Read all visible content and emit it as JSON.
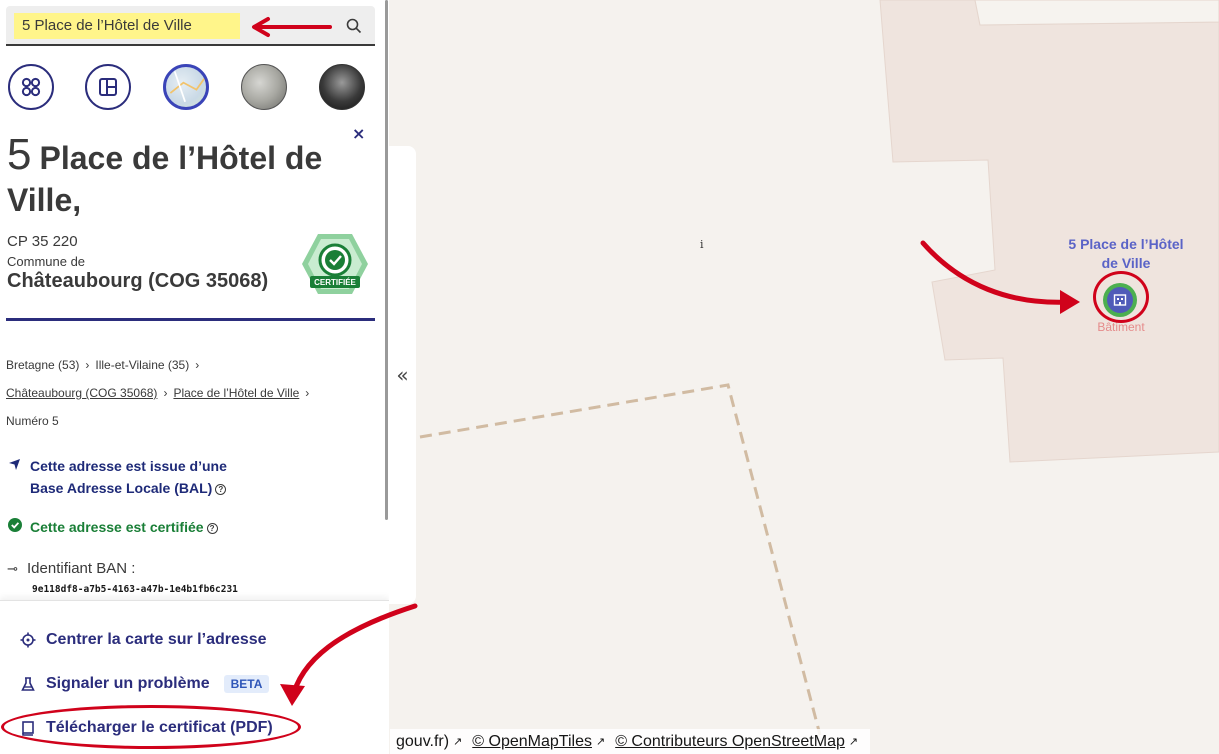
{
  "search": {
    "value": "5 Place de l’Hôtel de Ville"
  },
  "map_styles": [
    {
      "icon": "grid-four-icon",
      "label": ""
    },
    {
      "icon": "layout-icon",
      "label": ""
    },
    {
      "icon": "plan-thumbnail",
      "label": ""
    },
    {
      "icon": "photo-thumbnail",
      "label": ""
    },
    {
      "icon": "dark-thumbnail",
      "label": ""
    }
  ],
  "address": {
    "number": "5",
    "street": "Place de l’Hôtel de Ville,",
    "postal_code": "CP 35 220",
    "commune_label": "Commune de",
    "commune_name": "Châteaubourg (COG 35068)",
    "badge_text": "CERTIFIÉE",
    "breadcrumb": {
      "region": "Bretagne (53)",
      "departement": "Ille-et-Vilaine (35)",
      "commune": "Châteaubourg (COG 35068)",
      "voie": "Place de l’Hôtel de Ville",
      "numero": "Numéro 5"
    },
    "bal_line1": "Cette adresse est issue d’une",
    "bal_line2": "Base Adresse Locale (BAL)",
    "certified_text": "Cette adresse est certifiée",
    "ban_label": "Identifiant BAN :",
    "ban_id": "9e118df8-a7b5-4163-a47b-1e4b1fb6c231"
  },
  "actions": {
    "center": "Centrer la carte sur l’adresse",
    "report": "Signaler un problème",
    "report_badge": "BETA",
    "download": "Télécharger le certificat (PDF)"
  },
  "map": {
    "info_glyph": "i",
    "poi_label": "5 Place de l’Hôtel de Ville",
    "poi_type": "Bâtiment",
    "collapse_glyph": "«"
  },
  "attribution": {
    "part1": "gouv.fr)",
    "part2": "© OpenMapTiles",
    "part3": "© Contributeurs OpenStreetMap"
  },
  "colors": {
    "primary": "#2b2d7c",
    "certified_green": "#1a7f37",
    "annotation_red": "#d0021b",
    "search_highlight": "#fff58a"
  }
}
